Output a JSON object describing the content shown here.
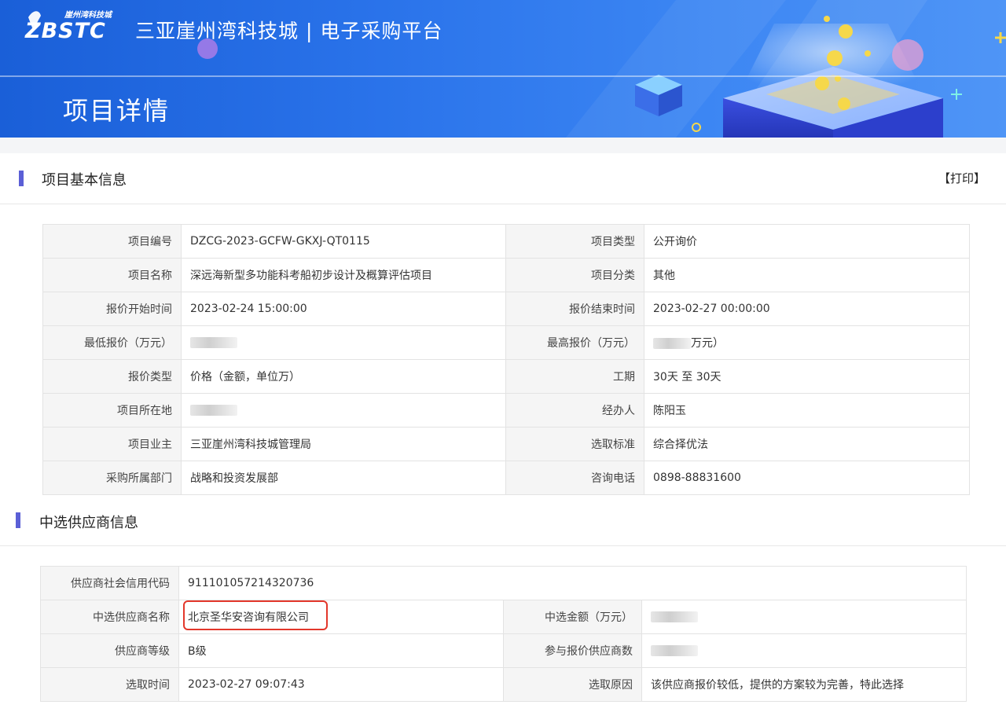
{
  "header": {
    "logo_text": "ZBSTC",
    "logo_subtext": "崖州湾科技城",
    "site_title": "三亚崖州湾科技城 | 电子采购平台",
    "page_heading": "项目详情"
  },
  "basic": {
    "section_title": "项目基本信息",
    "print_label": "【打印】",
    "rows": [
      [
        {
          "label": "项目编号",
          "value": "DZCG-2023-GCFW-GKXJ-QT0115"
        },
        {
          "label": "项目类型",
          "value": "公开询价"
        }
      ],
      [
        {
          "label": "项目名称",
          "value": "深远海新型多功能科考船初步设计及概算评估项目"
        },
        {
          "label": "项目分类",
          "value": "其他"
        }
      ],
      [
        {
          "label": "报价开始时间",
          "value": "2023-02-24 15:00:00"
        },
        {
          "label": "报价结束时间",
          "value": "2023-02-27 00:00:00"
        }
      ],
      [
        {
          "label": "最低报价（万元）",
          "value": ""
        },
        {
          "label": "最高报价（万元）",
          "value": "万元）"
        }
      ],
      [
        {
          "label": "报价类型",
          "value": "价格（金额，单位万）"
        },
        {
          "label": "工期",
          "value": "30天 至 30天"
        }
      ],
      [
        {
          "label": "项目所在地",
          "value": ""
        },
        {
          "label": "经办人",
          "value": "陈阳玉"
        }
      ],
      [
        {
          "label": "项目业主",
          "value": "三亚崖州湾科技城管理局"
        },
        {
          "label": "选取标准",
          "value": "综合择优法"
        }
      ],
      [
        {
          "label": "采购所属部门",
          "value": "战略和投资发展部"
        },
        {
          "label": "咨询电话",
          "value": "0898-88831600"
        }
      ]
    ]
  },
  "supplier": {
    "section_title": "中选供应商信息",
    "credit_code_label": "供应商社会信用代码",
    "credit_code": "911101057214320736",
    "rows": [
      [
        {
          "label": "中选供应商名称",
          "value": "北京圣华安咨询有限公司"
        },
        {
          "label": "中选金额（万元）",
          "value": ""
        }
      ],
      [
        {
          "label": "供应商等级",
          "value": "B级"
        },
        {
          "label": "参与报价供应商数",
          "value": ""
        }
      ],
      [
        {
          "label": "选取时间",
          "value": "2023-02-27 09:07:43"
        },
        {
          "label": "选取原因",
          "value": "该供应商报价较低，提供的方案较为完善，特此选择"
        }
      ]
    ]
  },
  "colors": {
    "accent_bar": "#5b5fd6",
    "highlight_border": "#e3372b",
    "banner_blue": "#2a73ea"
  }
}
